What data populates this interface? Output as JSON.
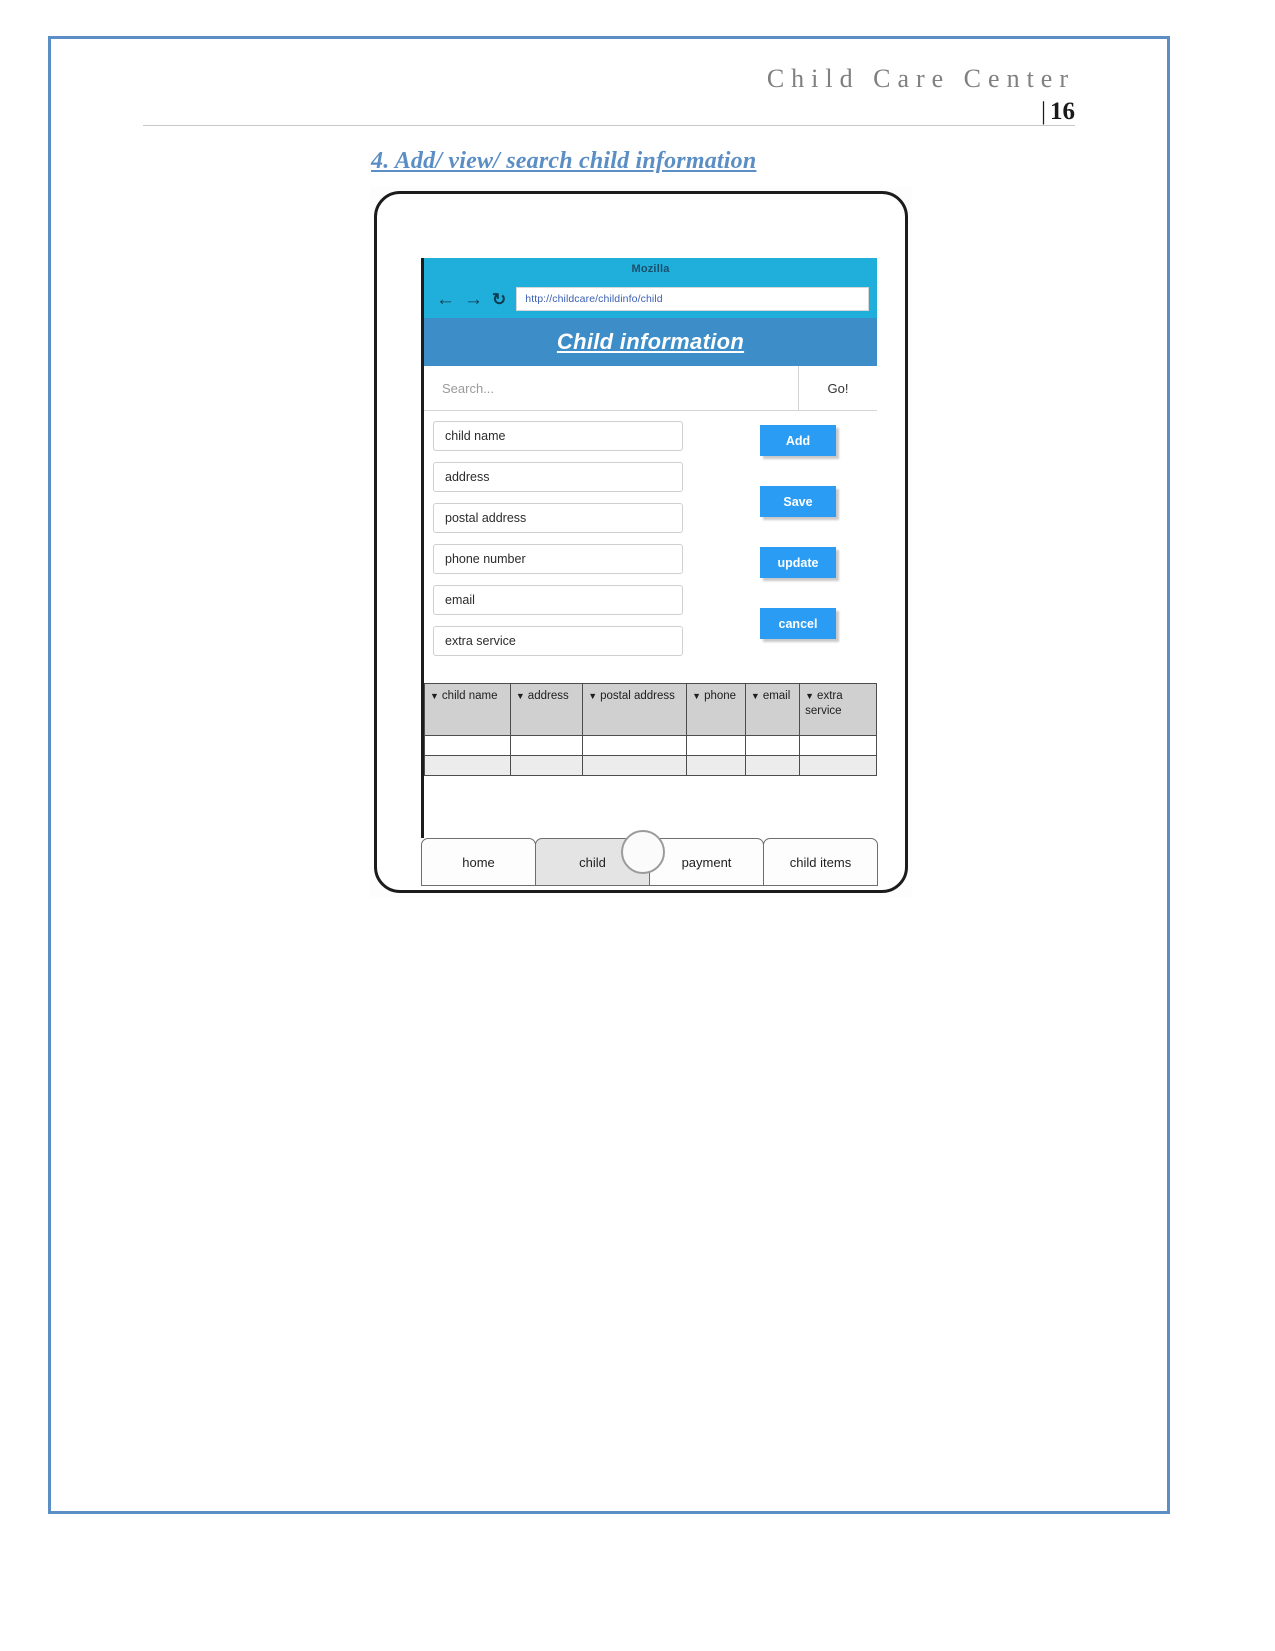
{
  "document": {
    "header_title": "Child Care Center",
    "page_marker": "|",
    "page_number": "16",
    "section_heading": "4. Add/ view/ search child information"
  },
  "browser": {
    "window_title": "Mozilla",
    "back_icon": "←",
    "forward_icon": "→",
    "reload_icon": "↻",
    "url": "http://childcare/childinfo/child"
  },
  "app": {
    "banner_title": "Child information",
    "search": {
      "placeholder": "Search...",
      "go_label": "Go!"
    },
    "fields": [
      {
        "name": "child-name",
        "label": "child name"
      },
      {
        "name": "address",
        "label": "address"
      },
      {
        "name": "postal-address",
        "label": "postal address"
      },
      {
        "name": "phone-number",
        "label": "phone number"
      },
      {
        "name": "email",
        "label": "email"
      },
      {
        "name": "extra-service",
        "label": "extra service"
      }
    ],
    "buttons": [
      {
        "name": "add",
        "label": "Add"
      },
      {
        "name": "save",
        "label": "Save"
      },
      {
        "name": "update",
        "label": "update"
      },
      {
        "name": "cancel",
        "label": "cancel"
      }
    ],
    "table": {
      "sort_caret": "▼",
      "columns": [
        "child name",
        "address",
        "postal address",
        "phone",
        "email",
        "extra service"
      ],
      "rows": []
    },
    "tabs": [
      {
        "name": "home",
        "label": "home",
        "selected": false
      },
      {
        "name": "child",
        "label": "child",
        "selected": true
      },
      {
        "name": "payment",
        "label": "payment",
        "selected": false
      },
      {
        "name": "child-items",
        "label": "child items",
        "selected": false
      }
    ]
  },
  "colors": {
    "page_border": "#5b8ec4",
    "heading": "#5b8ec4",
    "browser_chrome": "#20aedb",
    "app_banner": "#3c8dc8",
    "button": "#2b9cf4",
    "table_header": "#d0d0d0"
  }
}
